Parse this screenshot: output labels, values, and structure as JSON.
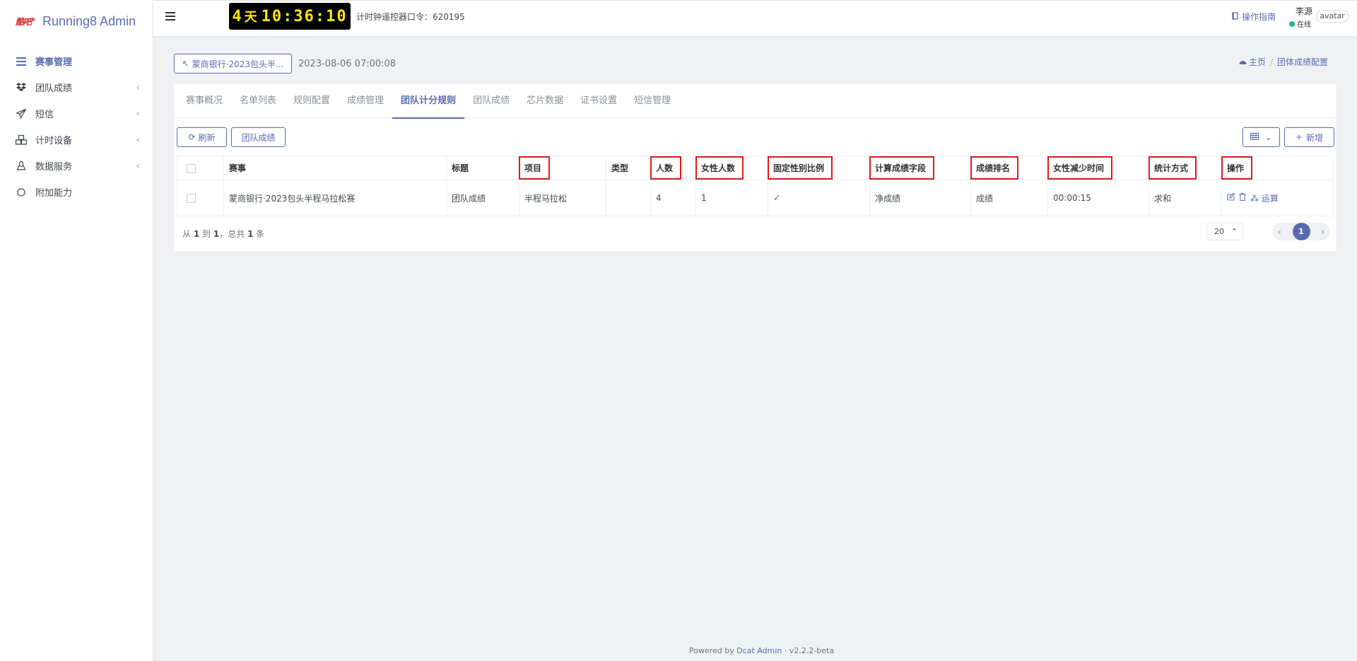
{
  "brand": {
    "logo": "酷吧",
    "name": "Running8 Admin"
  },
  "sidebar": {
    "items": [
      {
        "label": "赛事管理",
        "icon": "list-icon",
        "active": true,
        "caret": ""
      },
      {
        "label": "团队成绩",
        "icon": "dropbox-icon",
        "active": false,
        "caret": "‹"
      },
      {
        "label": "短信",
        "icon": "paper-plane-icon",
        "active": false,
        "caret": "‹"
      },
      {
        "label": "计时设备",
        "icon": "cubes-icon",
        "active": false,
        "caret": "‹"
      },
      {
        "label": "数据服务",
        "icon": "linux-icon",
        "active": false,
        "caret": "‹"
      },
      {
        "label": "附加能力",
        "icon": "circle-icon",
        "active": false,
        "caret": ""
      }
    ]
  },
  "topbar": {
    "clock_days": "4",
    "clock_unit": "天",
    "clock_time": "10:36:10",
    "command_label": "计时钟遥控器口令：620195",
    "guide": "操作指南",
    "user_name": "李源",
    "user_status": "在线",
    "avatar_alt": "avatar"
  },
  "header": {
    "back_label": "蒙商银行·2023包头半...",
    "event_date": "2023-08-06 07:00:08",
    "breadcrumb_home": "主页",
    "breadcrumb_current": "团体成绩配置"
  },
  "tabs": [
    "赛事概况",
    "名单列表",
    "规则配置",
    "成绩管理",
    "团队计分规则",
    "团队成绩",
    "芯片数据",
    "证书设置",
    "短信管理"
  ],
  "active_tab": "团队计分规则",
  "toolbar": {
    "refresh": "刷新",
    "team_results": "团队成绩",
    "add": "新增"
  },
  "table": {
    "headers": [
      "赛事",
      "标题",
      "项目",
      "类型",
      "人数",
      "女性人数",
      "固定性别比例",
      "计算成绩字段",
      "成绩排名",
      "女性减少时间",
      "统计方式",
      "操作"
    ],
    "rows": [
      {
        "event": "蒙商银行·2023包头半程马拉松赛",
        "title": "团队成绩",
        "project": "半程马拉松",
        "type": "",
        "count": "4",
        "female_count": "1",
        "fixed_ratio": "✓",
        "calc_field": "净成绩",
        "ranking": "成绩",
        "female_reduction": "00:00:15",
        "stat_method": "求和",
        "calc_action": "运算"
      }
    ]
  },
  "pagination": {
    "summary_from": "从",
    "summary_a": "1",
    "summary_to": "到",
    "summary_b": "1",
    "summary_total": "，总共",
    "summary_n": "1",
    "summary_unit": "条",
    "per_page": "20",
    "current_page": "1"
  },
  "footer": {
    "powered": "Powered by",
    "link": "Dcat Admin",
    "sep": "·",
    "version": "v2.2.2-beta"
  }
}
